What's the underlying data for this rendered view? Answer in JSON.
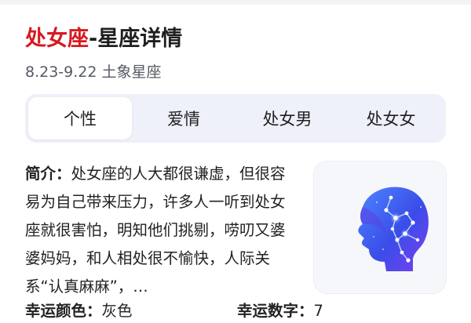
{
  "header": {
    "title_accent": "处女座",
    "title_rest": "-星座详情",
    "subtitle": "8.23-9.22 土象星座"
  },
  "tabs": [
    {
      "label": "个性",
      "active": true
    },
    {
      "label": "爱情",
      "active": false
    },
    {
      "label": "处女男",
      "active": false
    },
    {
      "label": "处女女",
      "active": false
    }
  ],
  "intro": {
    "label": "简介：",
    "text": "处女座的人大都很谦虚，但很容易为自己带来压力，许多人一听到处女座就很害怕，明知他们挑剔，唠叨又婆婆妈妈，和人相处很不愉快，人际关系“认真麻麻”，…"
  },
  "lucky": {
    "color_label": "幸运颜色：",
    "color_value": "灰色",
    "number_label": "幸运数字：",
    "number_value": "7"
  },
  "image": {
    "icon": "virgo-constellation-head-icon",
    "colors": {
      "primary": "#3a5bff",
      "secondary": "#7b3ff2"
    }
  },
  "colors": {
    "accent": "#d71920",
    "tab_bg": "#eef1f9"
  }
}
